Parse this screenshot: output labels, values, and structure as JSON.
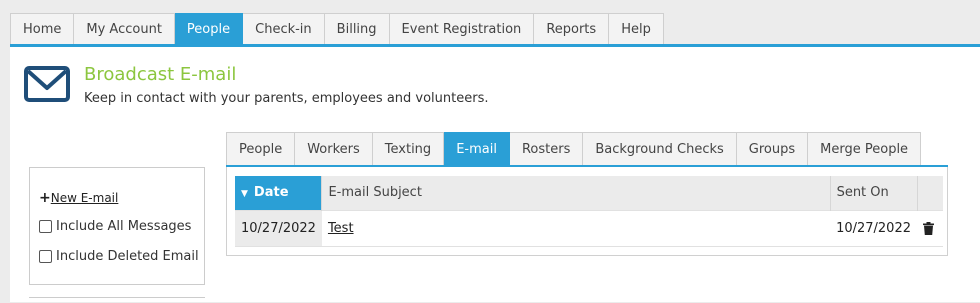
{
  "topnav": {
    "tabs": [
      {
        "label": "Home"
      },
      {
        "label": "My Account"
      },
      {
        "label": "People"
      },
      {
        "label": "Check-in"
      },
      {
        "label": "Billing"
      },
      {
        "label": "Event Registration"
      },
      {
        "label": "Reports"
      },
      {
        "label": "Help"
      }
    ],
    "active": "People"
  },
  "header": {
    "title": "Broadcast E-mail",
    "subtitle": "Keep in contact with your parents, employees and volunteers.",
    "icon": "envelope-icon"
  },
  "sidebar": {
    "new_email": "New E-mail",
    "options": [
      {
        "label": "Include All Messages",
        "checked": false
      },
      {
        "label": "Include Deleted Email",
        "checked": false
      }
    ]
  },
  "subtabs": {
    "tabs": [
      {
        "label": "People"
      },
      {
        "label": "Workers"
      },
      {
        "label": "Texting"
      },
      {
        "label": "E-mail"
      },
      {
        "label": "Rosters"
      },
      {
        "label": "Background Checks"
      },
      {
        "label": "Groups"
      },
      {
        "label": "Merge People"
      }
    ],
    "active": "E-mail"
  },
  "table": {
    "columns": [
      "Date",
      "E-mail Subject",
      "Sent On"
    ],
    "sort_column": "Date",
    "rows": [
      {
        "date": "10/27/2022",
        "subject": "Test",
        "sent_on": "10/27/2022"
      }
    ]
  },
  "colors": {
    "accent": "#2a9fd6",
    "title_green": "#8cc63f",
    "icon_navy": "#1f4e79"
  }
}
